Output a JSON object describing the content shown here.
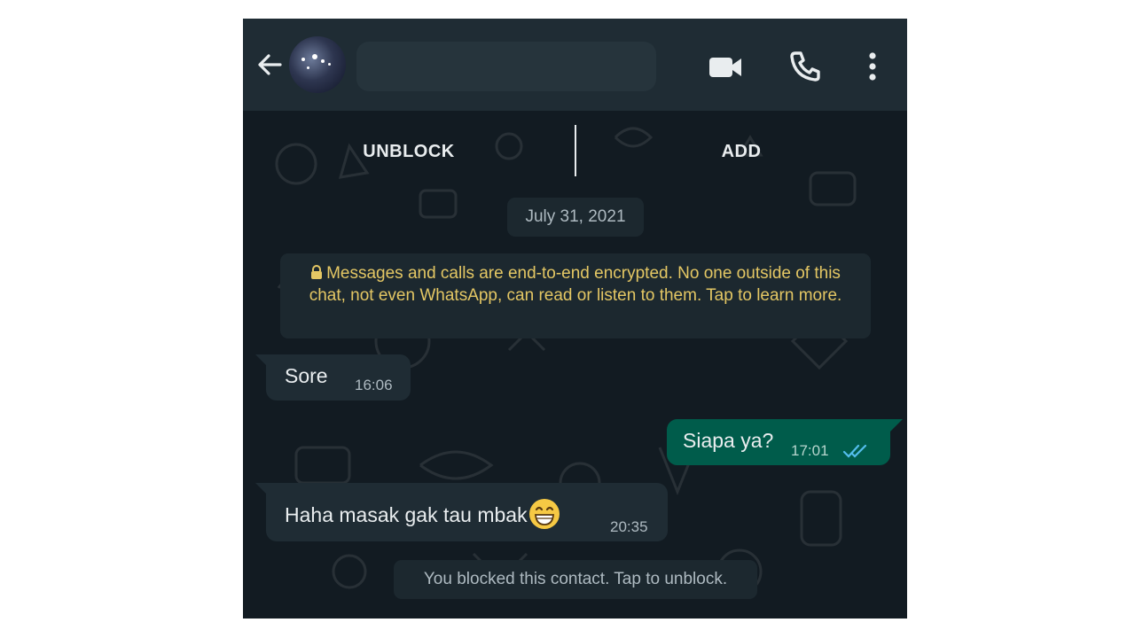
{
  "header": {
    "back_icon": "arrow-left-icon",
    "video_icon": "videocam-icon",
    "call_icon": "phone-icon",
    "more_icon": "more-vert-icon"
  },
  "actions": {
    "unblock_label": "UNBLOCK",
    "add_label": "ADD"
  },
  "chat": {
    "date_label": "July 31, 2021",
    "encryption_notice": "Messages and calls are end-to-end encrypted. No one outside of this chat, not even WhatsApp, can read or listen to them. Tap to learn more.",
    "messages": [
      {
        "direction": "incoming",
        "text": "Sore",
        "time": "16:06"
      },
      {
        "direction": "outgoing",
        "text": "Siapa ya?",
        "time": "17:01",
        "status": "read"
      },
      {
        "direction": "incoming",
        "text": "Haha masak gak tau mbak",
        "emoji": "😁",
        "time": "20:35"
      }
    ],
    "blocked_notice": "You blocked this contact. Tap to unblock."
  },
  "colors": {
    "appbar": "#1f2c34",
    "background": "#121b22",
    "incoming_bubble": "#1f2c34",
    "outgoing_bubble": "#005c4b",
    "encryption_text": "#e4c764",
    "read_ticks": "#53bdeb"
  }
}
